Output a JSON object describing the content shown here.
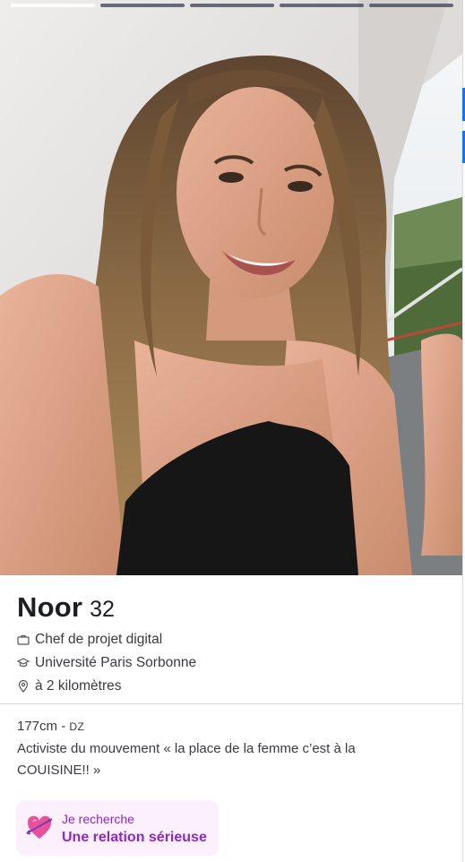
{
  "photo": {
    "alt": "Photo de profil",
    "progress_segments": 5,
    "active_segment": 0
  },
  "profile": {
    "name": "Noor",
    "age": "32",
    "job": "Chef de projet digital",
    "school": "Université Paris Sorbonne",
    "distance": "à 2 kilomètres",
    "height": "177cm",
    "separator": " - ",
    "country": "DZ",
    "bio": "Activiste du mouvement « la place de la femme c’est à la COUISINE!! »"
  },
  "goal": {
    "label": "Je recherche",
    "value": "Une relation sérieuse"
  },
  "icons": {
    "job": "briefcase-icon",
    "school": "graduation-cap-icon",
    "distance": "location-pin-icon",
    "goal": "heart-arrow-icon"
  },
  "colors": {
    "accent": "#8a2ac4",
    "goal_bg": "#fbf0fc",
    "progress_active": "#ffffff",
    "progress_inactive": "#3c4050"
  }
}
